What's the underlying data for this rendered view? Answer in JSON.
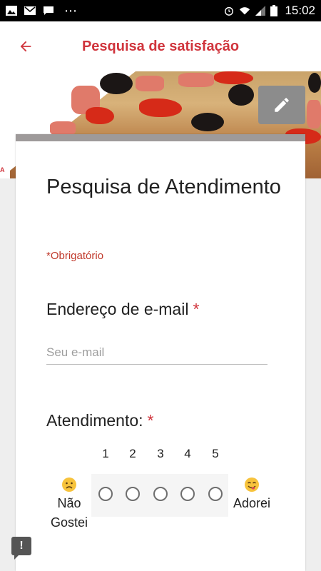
{
  "status_bar": {
    "time": "15:02",
    "left_icons": [
      "image-icon",
      "mail-icon",
      "message-icon",
      "more-dots"
    ],
    "right_icons": [
      "alarm-icon",
      "wifi-icon",
      "signal-icon",
      "battery-icon"
    ]
  },
  "app_bar": {
    "title": "Pesquisa de satisfação",
    "back_icon": "arrow-left-icon"
  },
  "colors": {
    "accent": "#d0343c",
    "card_top_bar": "#9e9a9a",
    "required": "#c0392b"
  },
  "form": {
    "title": "Pesquisa de Atendimento",
    "required_note": "*Obrigatório",
    "questions": {
      "email": {
        "label": "Endereço de e-mail",
        "required_mark": "*",
        "placeholder": "Seu e-mail",
        "value": ""
      },
      "service": {
        "label": "Atendimento:",
        "required_mark": "*",
        "scale": [
          "1",
          "2",
          "3",
          "4",
          "5"
        ],
        "low_label": "Não Gostei",
        "high_label": "Adorei",
        "selected": null
      }
    }
  }
}
